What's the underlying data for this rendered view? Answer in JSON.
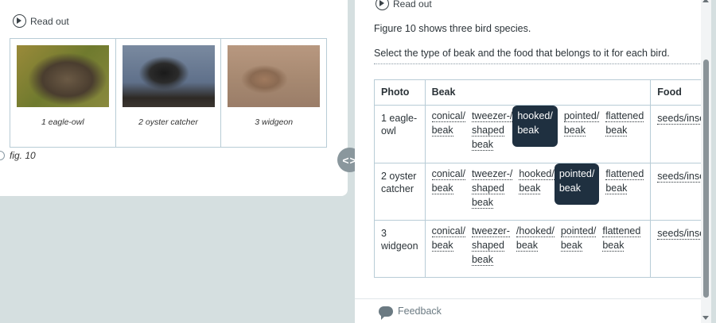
{
  "readout_label": "Read out",
  "figure": {
    "label": "fig. 10",
    "items": [
      {
        "caption": "1 eagle-owl"
      },
      {
        "caption": "2 oyster catcher"
      },
      {
        "caption": "3 widgeon"
      }
    ]
  },
  "divider_toggle": "<>",
  "task": {
    "intro": "Figure 10 shows three bird species.",
    "instruction": "Select the type of beak and the food that belongs to it for each bird.",
    "headers": [
      "Photo",
      "Beak",
      "Food"
    ],
    "rows": [
      {
        "photo": "1 eagle-owl",
        "options": [
          {
            "top": "conical/",
            "bottom": "beak",
            "extra": ""
          },
          {
            "top": "tweezer-/",
            "bottom": "shaped",
            "extra": "beak"
          },
          {
            "top": "hooked/",
            "bottom": "beak",
            "extra": "",
            "selected": true
          },
          {
            "top": "pointed/",
            "bottom": "beak",
            "extra": ""
          },
          {
            "top": "flattened",
            "bottom": "beak",
            "extra": ""
          }
        ],
        "food": "seeds/insec"
      },
      {
        "photo": "2 oyster catcher",
        "options": [
          {
            "top": "conical/",
            "bottom": "beak",
            "extra": ""
          },
          {
            "top": "tweezer-/",
            "bottom": "shaped",
            "extra": "beak"
          },
          {
            "top": "hooked/",
            "bottom": "beak",
            "extra": ""
          },
          {
            "top": "pointed/",
            "bottom": "beak",
            "extra": "",
            "selected": true
          },
          {
            "top": "flattened",
            "bottom": "beak",
            "extra": ""
          }
        ],
        "food": "seeds/insec"
      },
      {
        "photo": "3 widgeon",
        "options": [
          {
            "top": "conical/",
            "bottom": "beak",
            "extra": ""
          },
          {
            "top": "tweezer-",
            "bottom": "shaped",
            "extra": "beak"
          },
          {
            "top": "/hooked/",
            "bottom": "beak",
            "extra": ""
          },
          {
            "top": "pointed/",
            "bottom": "beak",
            "extra": ""
          },
          {
            "top": "flattened",
            "bottom": "beak",
            "extra": ""
          }
        ],
        "food": "seeds/insec"
      }
    ]
  },
  "feedback_label": "Feedback",
  "colors": {
    "selected_bg": "#1f3040",
    "panel_bg": "#d5dfe0",
    "border": "#b8ccd6"
  }
}
